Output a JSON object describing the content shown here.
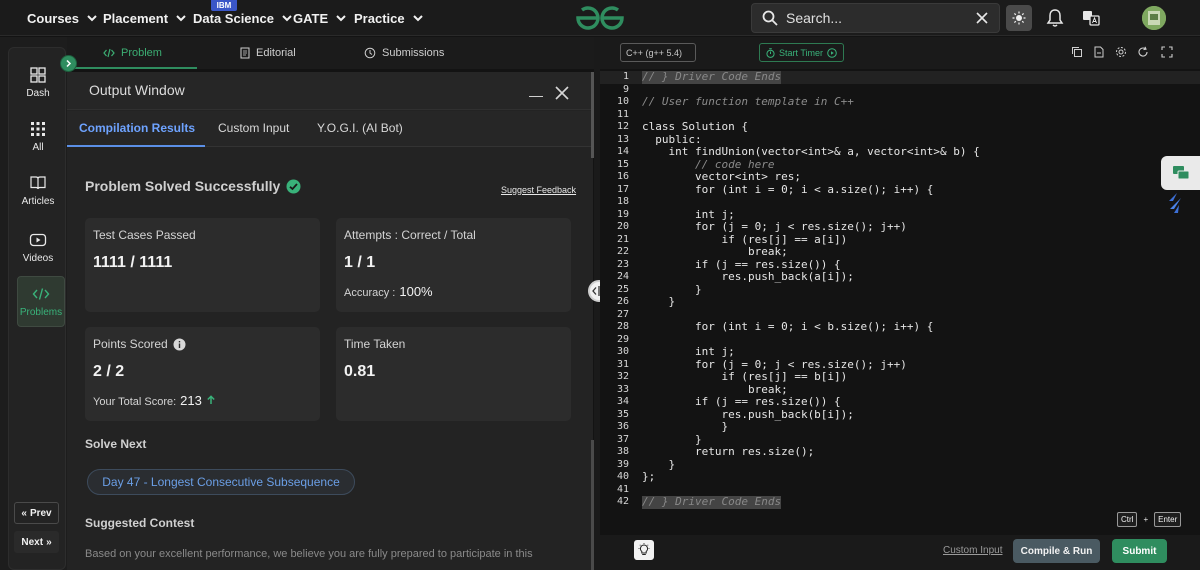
{
  "nav": {
    "items": [
      {
        "label": "Courses"
      },
      {
        "label": "Placement"
      },
      {
        "label": "Data Science",
        "badge": "IBM"
      },
      {
        "label": "GATE"
      },
      {
        "label": "Practice"
      }
    ],
    "search_placeholder": "Search...",
    "icons": [
      "search-icon",
      "close-icon",
      "theme-icon",
      "bell-icon",
      "translate-icon"
    ]
  },
  "sidebar": {
    "items": [
      {
        "label": "Dash",
        "icon": "dashboard-icon"
      },
      {
        "label": "All",
        "icon": "grid-icon"
      },
      {
        "label": "Articles",
        "icon": "book-icon"
      },
      {
        "label": "Videos",
        "icon": "video-icon"
      },
      {
        "label": "Problems",
        "icon": "code-icon"
      }
    ],
    "prev_label": "Prev",
    "next_label": "Next"
  },
  "problem_tabs": [
    {
      "label": "Problem",
      "icon": "code-icon"
    },
    {
      "label": "Editorial",
      "icon": "document-icon"
    },
    {
      "label": "Submissions",
      "icon": "clock-icon"
    }
  ],
  "output": {
    "title": "Output Window",
    "tabs": [
      {
        "label": "Compilation Results"
      },
      {
        "label": "Custom Input"
      },
      {
        "label": "Y.O.G.I. (AI Bot)"
      }
    ],
    "status": "Problem Solved Successfully",
    "feedback_link": "Suggest Feedback",
    "cards": {
      "tests": {
        "label": "Test Cases Passed",
        "value": "1111 / 1111"
      },
      "attempts": {
        "label": "Attempts : Correct / Total",
        "value": "1 / 1",
        "sub_label": "Accuracy :",
        "sub_value": "100%"
      },
      "points": {
        "label": "Points Scored",
        "value": "2 / 2",
        "sub_label": "Your Total Score:",
        "sub_value": "213"
      },
      "time": {
        "label": "Time Taken",
        "value": "0.81"
      }
    },
    "solve_next_title": "Solve Next",
    "solve_next_item": "Day 47 - Longest Consecutive Subsequence",
    "contest_title": "Suggested Contest",
    "contest_text": "Based on your excellent performance, we believe you are fully prepared to participate in this"
  },
  "editor": {
    "language": "C++ (g++ 5.4)",
    "timer_label": "Start Timer",
    "lines": [
      {
        "n": "1",
        "text": "// } Driver Code Ends"
      },
      {
        "n": "9",
        "text": ""
      },
      {
        "n": "10",
        "text": "// User function template in C++"
      },
      {
        "n": "11",
        "text": ""
      },
      {
        "n": "12",
        "text": "class Solution {"
      },
      {
        "n": "13",
        "text": "  public:"
      },
      {
        "n": "14",
        "text": "    int findUnion(vector<int>& a, vector<int>& b) {"
      },
      {
        "n": "15",
        "text": "        // code here"
      },
      {
        "n": "16",
        "text": "        vector<int> res;"
      },
      {
        "n": "17",
        "text": "        for (int i = 0; i < a.size(); i++) {"
      },
      {
        "n": "18",
        "text": ""
      },
      {
        "n": "19",
        "text": "        int j;"
      },
      {
        "n": "20",
        "text": "        for (j = 0; j < res.size(); j++)"
      },
      {
        "n": "21",
        "text": "            if (res[j] == a[i])"
      },
      {
        "n": "22",
        "text": "                break;"
      },
      {
        "n": "23",
        "text": "        if (j == res.size()) {"
      },
      {
        "n": "24",
        "text": "            res.push_back(a[i]);"
      },
      {
        "n": "25",
        "text": "        }"
      },
      {
        "n": "26",
        "text": "    }"
      },
      {
        "n": "27",
        "text": ""
      },
      {
        "n": "28",
        "text": "        for (int i = 0; i < b.size(); i++) {"
      },
      {
        "n": "29",
        "text": ""
      },
      {
        "n": "30",
        "text": "        int j;"
      },
      {
        "n": "31",
        "text": "        for (j = 0; j < res.size(); j++)"
      },
      {
        "n": "32",
        "text": "            if (res[j] == b[i])"
      },
      {
        "n": "33",
        "text": "                break;"
      },
      {
        "n": "34",
        "text": "        if (j == res.size()) {"
      },
      {
        "n": "35",
        "text": "            res.push_back(b[i]);"
      },
      {
        "n": "36",
        "text": "            }"
      },
      {
        "n": "37",
        "text": "        }"
      },
      {
        "n": "38",
        "text": "        return res.size();"
      },
      {
        "n": "39",
        "text": "    }"
      },
      {
        "n": "40",
        "text": "};"
      },
      {
        "n": "41",
        "text": ""
      },
      {
        "n": "42",
        "text": "// } Driver Code Ends"
      }
    ],
    "shortcut_ctrl": "Ctrl",
    "shortcut_plus": "+",
    "shortcut_enter": "Enter",
    "custom_input_link": "Custom Input",
    "run_label": "Compile & Run",
    "submit_label": "Submit"
  },
  "colors": {
    "accent": "#2f8d5f",
    "link": "#6ea3ff",
    "bg": "#131313"
  }
}
